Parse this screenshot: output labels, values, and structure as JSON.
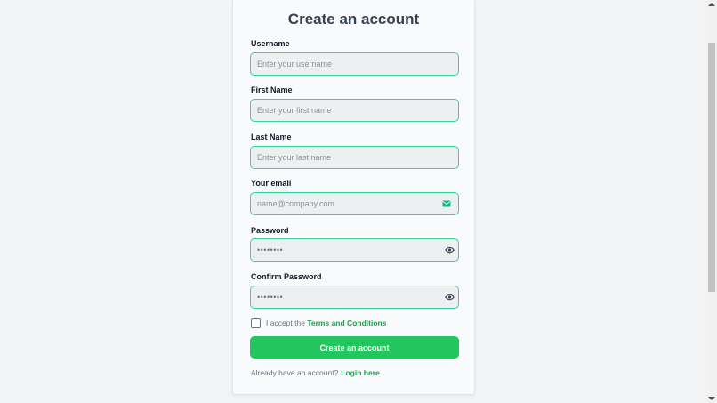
{
  "form": {
    "title": "Create an account",
    "username": {
      "label": "Username",
      "placeholder": "Enter your username"
    },
    "first_name": {
      "label": "First Name",
      "placeholder": "Enter your first name"
    },
    "last_name": {
      "label": "Last Name",
      "placeholder": "Enter your last name"
    },
    "email": {
      "label": "Your email",
      "placeholder": "name@company.com",
      "icon": "envelope-icon"
    },
    "password": {
      "label": "Password",
      "placeholder": "••••••••",
      "icon": "eye-icon"
    },
    "confirm_password": {
      "label": "Confirm Password",
      "placeholder": "••••••••",
      "icon": "eye-icon"
    },
    "terms": {
      "prefix": "I accept the",
      "link": "Terms and Conditions",
      "checked": false
    },
    "submit_label": "Create an account",
    "footer": {
      "text": "Already have an account?",
      "link": "Login here"
    }
  },
  "colors": {
    "accent": "#22c55e",
    "field_border": "#34d399",
    "link": "#16a34a",
    "field_bg": "#ecf0f1"
  }
}
